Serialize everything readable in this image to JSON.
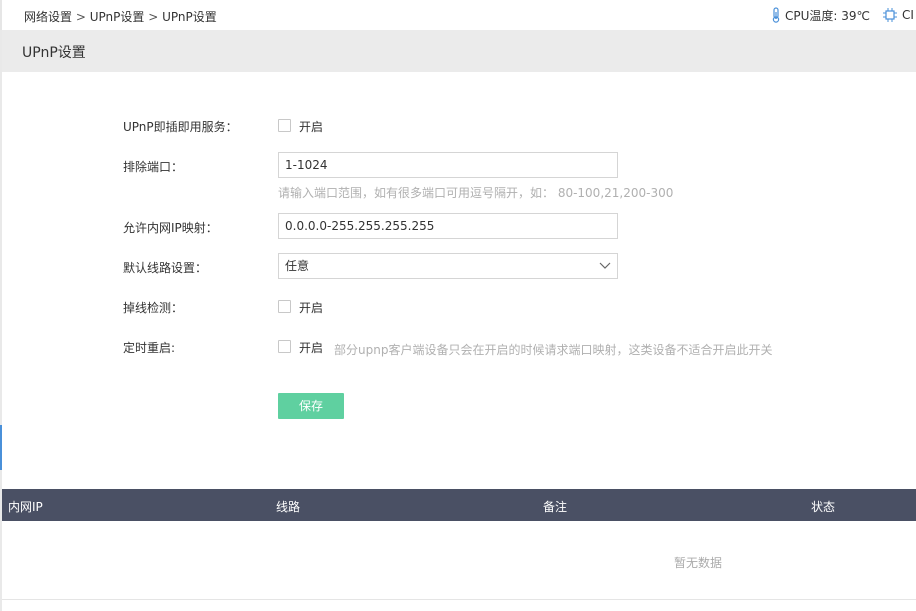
{
  "breadcrumb": {
    "items": [
      "网络设置",
      "UPnP设置",
      "UPnP设置"
    ],
    "separator": ">"
  },
  "status": {
    "cpu_temp": "CPU温度: 39℃",
    "cpu_usage_partial": "CI"
  },
  "page": {
    "title": "UPnP设置"
  },
  "form": {
    "upnp_service": {
      "label": "UPnP即插即用服务：",
      "checkbox_label": "开启"
    },
    "exclude_ports": {
      "label": "排除端口：",
      "value": "1-1024",
      "hint": "请输入端口范围，如有很多端口可用逗号隔开，如： 80-100,21,200-300"
    },
    "allow_ip_map": {
      "label": "允许内网IP映射：",
      "value": "0.0.0.0-255.255.255.255"
    },
    "default_line": {
      "label": "默认线路设置：",
      "selected": "任意"
    },
    "offline_detect": {
      "label": "掉线检测：",
      "checkbox_label": "开启"
    },
    "timed_restart": {
      "label": "定时重启:",
      "checkbox_label": "开启",
      "hint": "部分upnp客户端设备只会在开启的时候请求端口映射，这类设备不适合开启此开关"
    },
    "save_label": "保存"
  },
  "table": {
    "columns": [
      "内网IP",
      "线路",
      "备注",
      "状态"
    ],
    "empty_text": "暂无数据"
  },
  "colors": {
    "save_button": "#5fd0a0",
    "table_header": "#4a5064",
    "title_bar": "#ebebeb"
  }
}
